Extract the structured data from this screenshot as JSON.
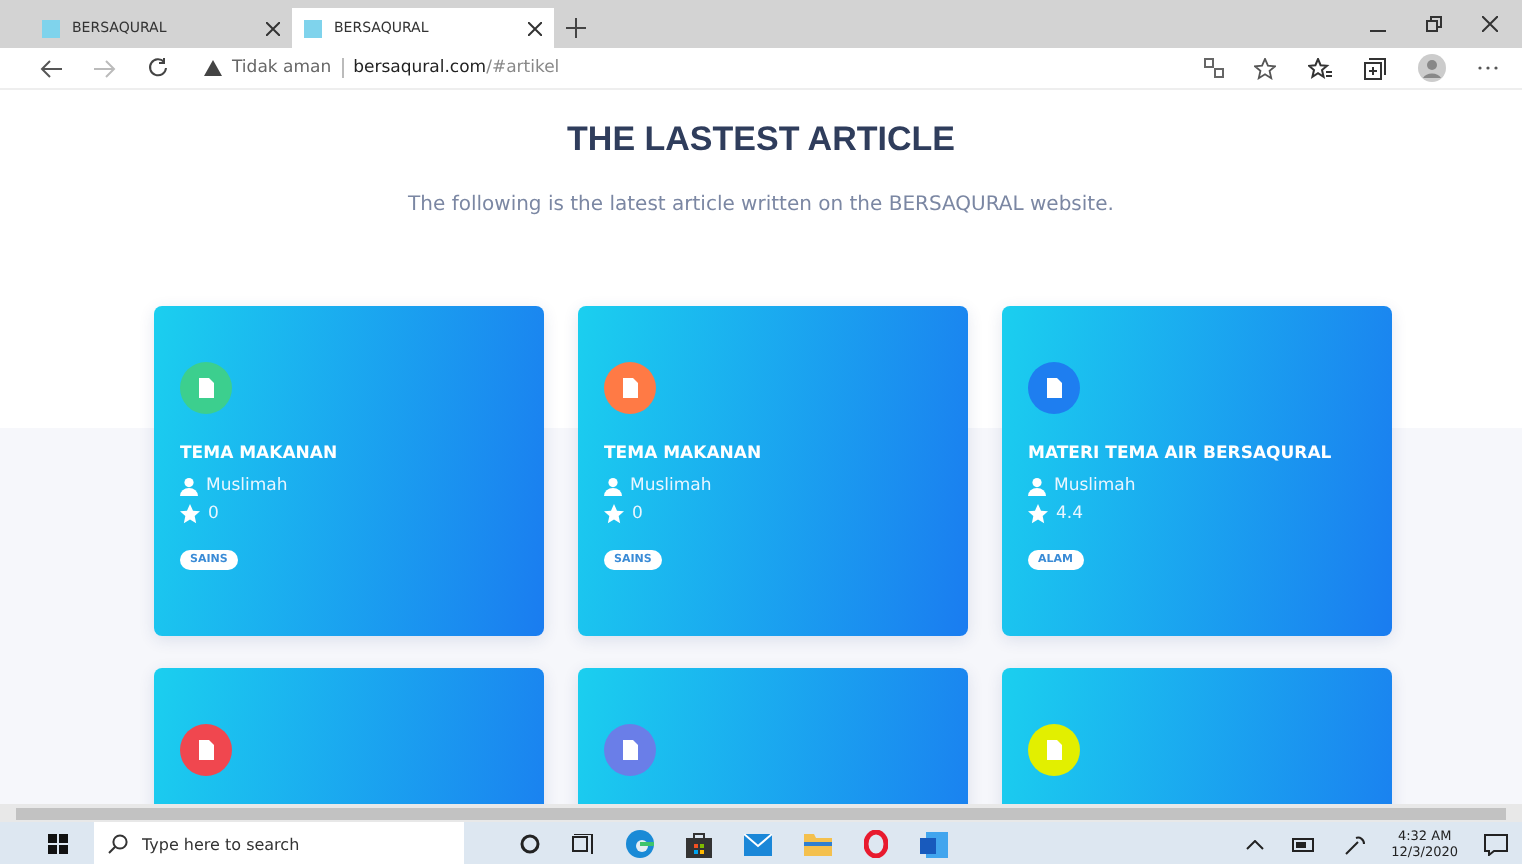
{
  "browser": {
    "tabs": [
      {
        "title": "BERSAQURAL",
        "selected": false
      },
      {
        "title": "BERSAQURAL",
        "selected": true
      }
    ],
    "security": "Tidak aman",
    "url_host": "bersaqural.com",
    "url_path": "/#artikel"
  },
  "page": {
    "heading": "THE LASTEST ARTICLE",
    "subtitle": "The following is the latest article written on the BERSAQURAL website.",
    "articles": [
      {
        "color": "#3ccf8e",
        "title": "TEMA MAKANAN",
        "author": "Muslimah",
        "rating": "0",
        "tag": "SAINS"
      },
      {
        "color": "#ff7a45",
        "title": "TEMA MAKANAN",
        "author": "Muslimah",
        "rating": "0",
        "tag": "SAINS"
      },
      {
        "color": "#1e7ef0",
        "title": "MATERI TEMA AIR BERSAQURAL",
        "author": "Muslimah",
        "rating": "4.4",
        "tag": "ALAM"
      },
      {
        "color": "#f0474f"
      },
      {
        "color": "#6a7ee8"
      },
      {
        "color": "#e2ef00"
      }
    ]
  },
  "taskbar": {
    "search_placeholder": "Type here to search",
    "time": "4:32 AM",
    "date": "12/3/2020"
  }
}
